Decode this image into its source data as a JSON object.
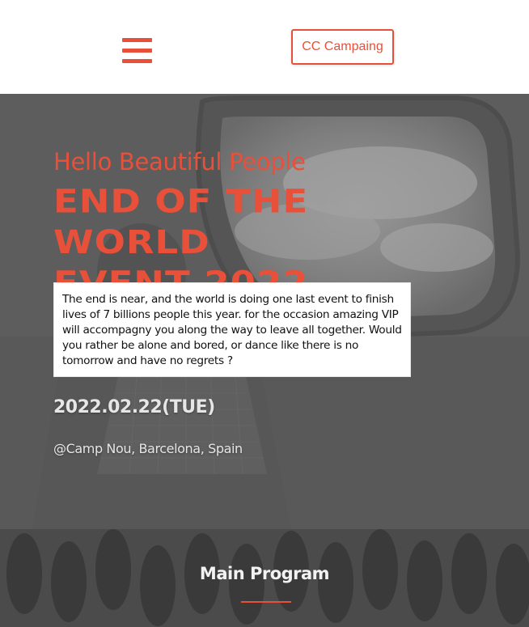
{
  "header": {
    "menu_icon": "hamburger-menu-icon",
    "brand_button_label": "CC Campaing"
  },
  "hero": {
    "subtitle": "Hello Beautiful People",
    "title_line1": "End of the World",
    "title_line2": "Event 2022",
    "description": "The end is near, and the world is doing one last event to finish lives of 7 billions people this year. for the occasion amazing VIP will accompagny you along the way to leave all together. Would you rather be alone and bored, or dance like there is no tomorrow and have no regrets ?",
    "date": "2022.02.22(TUE)",
    "venue": "@Camp Nou, Barcelona, Spain"
  },
  "program": {
    "title": "Main Program"
  },
  "colors": {
    "accent": "#e8503a",
    "hero_text": "#e6e6e6"
  }
}
